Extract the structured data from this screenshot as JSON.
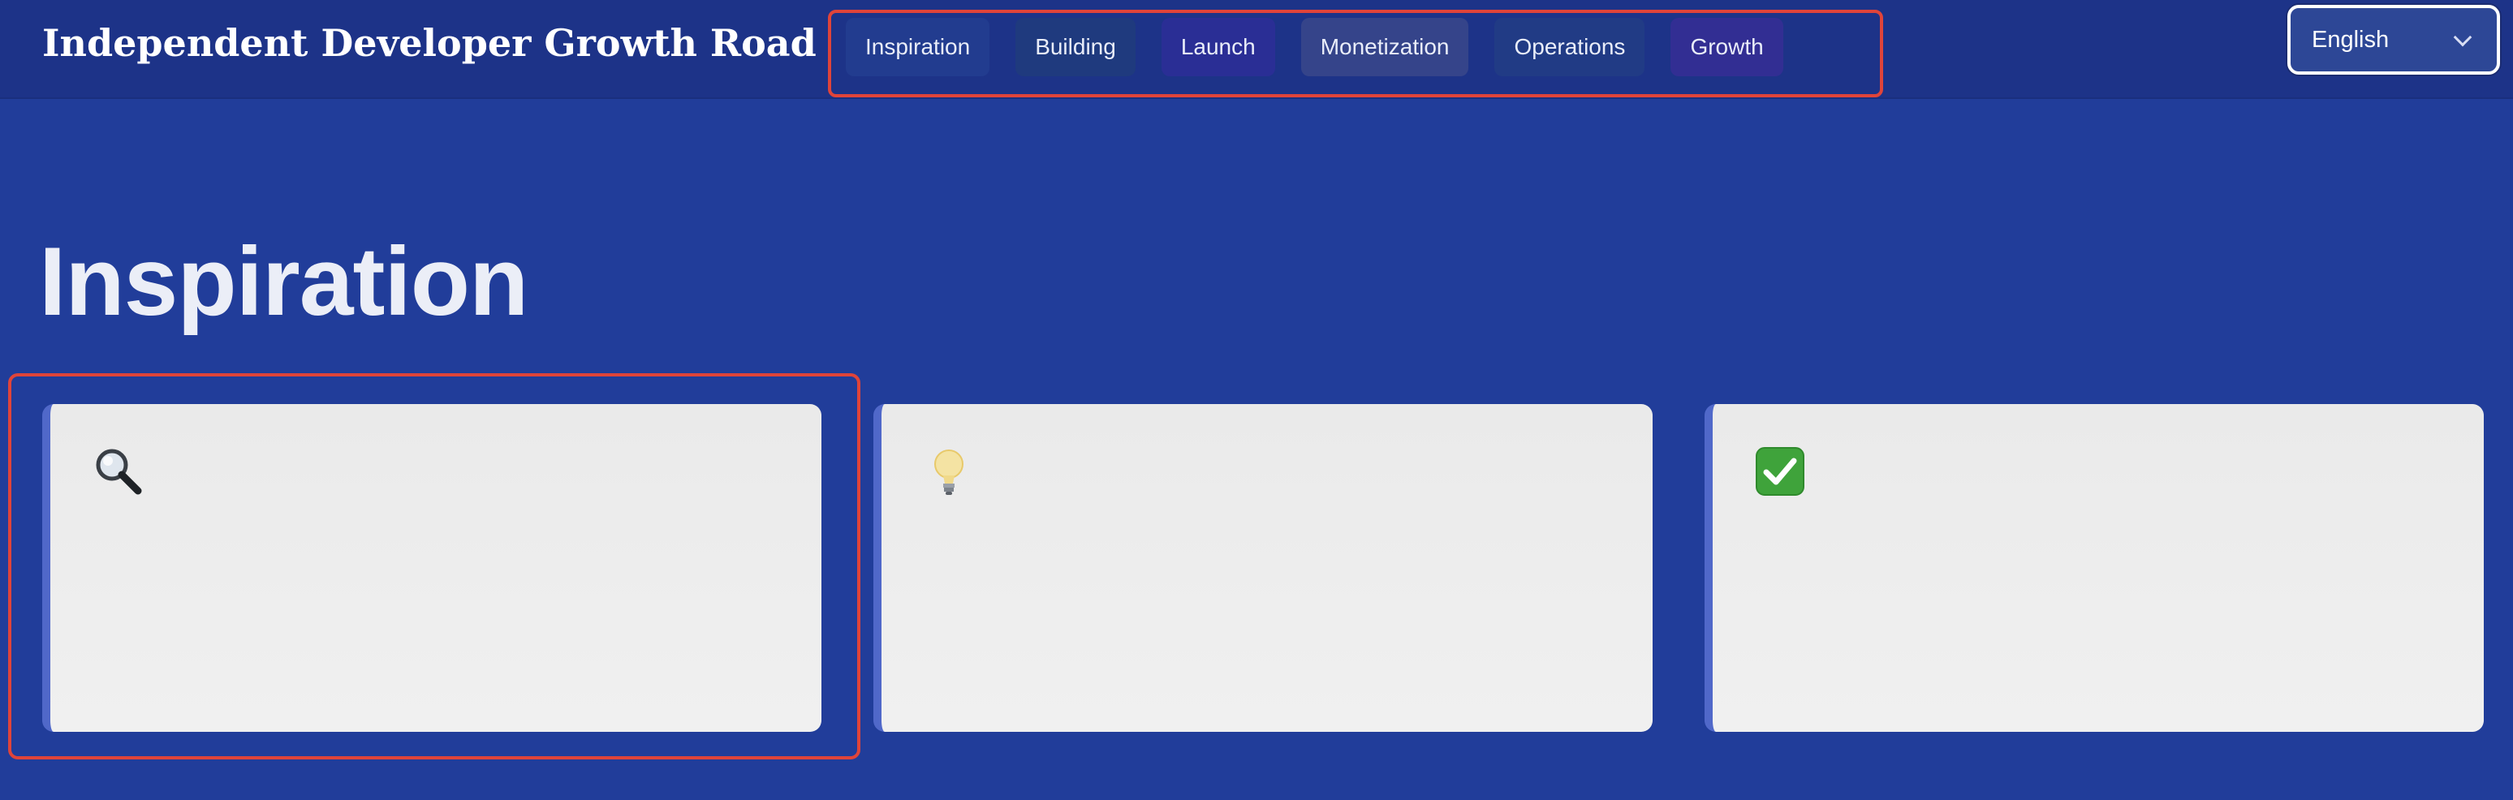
{
  "header": {
    "title": "Independent Developer Growth Road",
    "nav": [
      {
        "label": "Inspiration",
        "bg": "#223c8f"
      },
      {
        "label": "Building",
        "bg": "#1f3a7e"
      },
      {
        "label": "Launch",
        "bg": "#2a2e95"
      },
      {
        "label": "Monetization",
        "bg": "#35448a"
      },
      {
        "label": "Operations",
        "bg": "#213b85"
      },
      {
        "label": "Growth",
        "bg": "#322e93"
      }
    ],
    "language": {
      "selected": "English"
    }
  },
  "main": {
    "heading": "Inspiration",
    "cards": [
      {
        "icon": "magnifier-icon"
      },
      {
        "icon": "lightbulb-icon"
      },
      {
        "icon": "check-mark-icon"
      }
    ]
  },
  "colors": {
    "page_bg": "#213d9a",
    "topbar_bg": "#1d3388",
    "highlight": "#e0443a",
    "card_accent": "#5068c9"
  }
}
